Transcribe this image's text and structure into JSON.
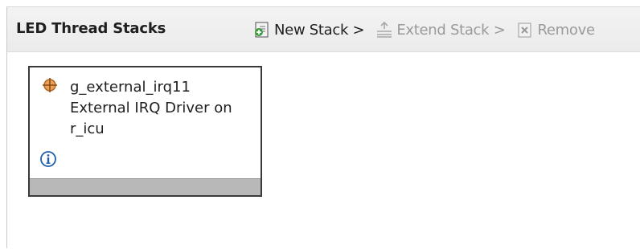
{
  "panel": {
    "title": "LED Thread Stacks"
  },
  "toolbar": {
    "new_stack": {
      "label": "New Stack >",
      "icon": "new-stack-icon",
      "enabled": true
    },
    "extend_stack": {
      "label": "Extend Stack >",
      "icon": "extend-stack-icon",
      "enabled": false
    },
    "remove": {
      "label": "Remove",
      "icon": "remove-icon",
      "enabled": false
    }
  },
  "module": {
    "name": "g_external_irq11",
    "description_line1": "External IRQ Driver on",
    "description_line2": "r_icu",
    "icon": "crosshair-module-icon",
    "info_icon": "info-icon"
  },
  "colors": {
    "header_bg": "#ededed",
    "module_border": "#3a3a3a",
    "module_footer": "#b8b8b8",
    "disabled_text": "#9a9a9a",
    "module_icon": "#c07a2a",
    "info_icon": "#1f5fa8"
  }
}
